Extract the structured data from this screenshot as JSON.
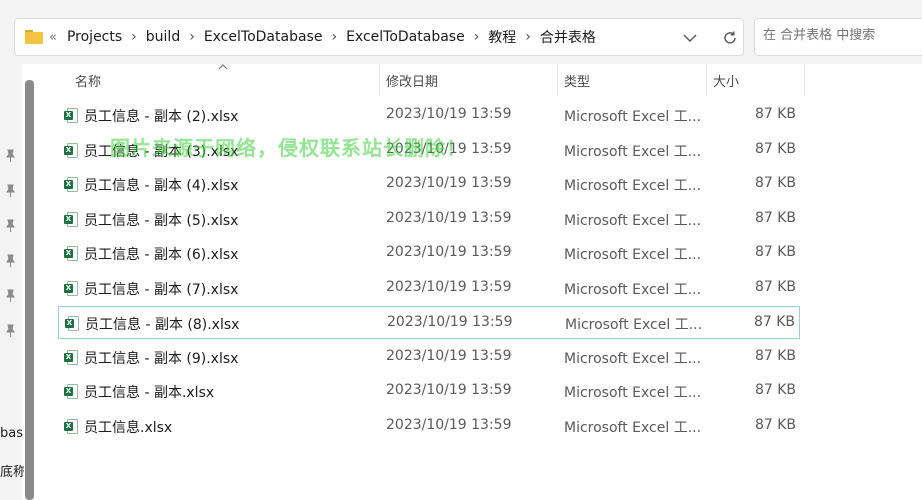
{
  "address_bar": {
    "overflow_label": "«",
    "crumbs": [
      "Projects",
      "build",
      "ExcelToDatabase",
      "ExcelToDatabase",
      "教程",
      "合并表格"
    ],
    "separator": "›"
  },
  "search": {
    "placeholder": "在 合并表格 中搜索"
  },
  "nav_fragments": [
    "bas",
    "底称"
  ],
  "columns": {
    "name": "名称",
    "date": "修改日期",
    "type": "类型",
    "size": "大小"
  },
  "files": [
    {
      "name": "员工信息 - 副本 (2).xlsx",
      "date": "2023/10/19 13:59",
      "type": "Microsoft Excel 工...",
      "size": "87 KB"
    },
    {
      "name": "员工信息 - 副本 (3).xlsx",
      "date": "2023/10/19 13:59",
      "type": "Microsoft Excel 工...",
      "size": "87 KB"
    },
    {
      "name": "员工信息 - 副本 (4).xlsx",
      "date": "2023/10/19 13:59",
      "type": "Microsoft Excel 工...",
      "size": "87 KB"
    },
    {
      "name": "员工信息 - 副本 (5).xlsx",
      "date": "2023/10/19 13:59",
      "type": "Microsoft Excel 工...",
      "size": "87 KB"
    },
    {
      "name": "员工信息 - 副本 (6).xlsx",
      "date": "2023/10/19 13:59",
      "type": "Microsoft Excel 工...",
      "size": "87 KB"
    },
    {
      "name": "员工信息 - 副本 (7).xlsx",
      "date": "2023/10/19 13:59",
      "type": "Microsoft Excel 工...",
      "size": "87 KB"
    },
    {
      "name": "员工信息 - 副本 (8).xlsx",
      "date": "2023/10/19 13:59",
      "type": "Microsoft Excel 工...",
      "size": "87 KB"
    },
    {
      "name": "员工信息 - 副本 (9).xlsx",
      "date": "2023/10/19 13:59",
      "type": "Microsoft Excel 工...",
      "size": "87 KB"
    },
    {
      "name": "员工信息 - 副本.xlsx",
      "date": "2023/10/19 13:59",
      "type": "Microsoft Excel 工...",
      "size": "87 KB"
    },
    {
      "name": "员工信息.xlsx",
      "date": "2023/10/19 13:59",
      "type": "Microsoft Excel 工...",
      "size": "87 KB"
    }
  ],
  "selected_index": 6,
  "watermark": "图片来源于网络，侵权联系站长删除！",
  "colors": {
    "selection_border": "#99d1db",
    "excel_green": "#1e7145",
    "watermark": "#3cd23c"
  }
}
